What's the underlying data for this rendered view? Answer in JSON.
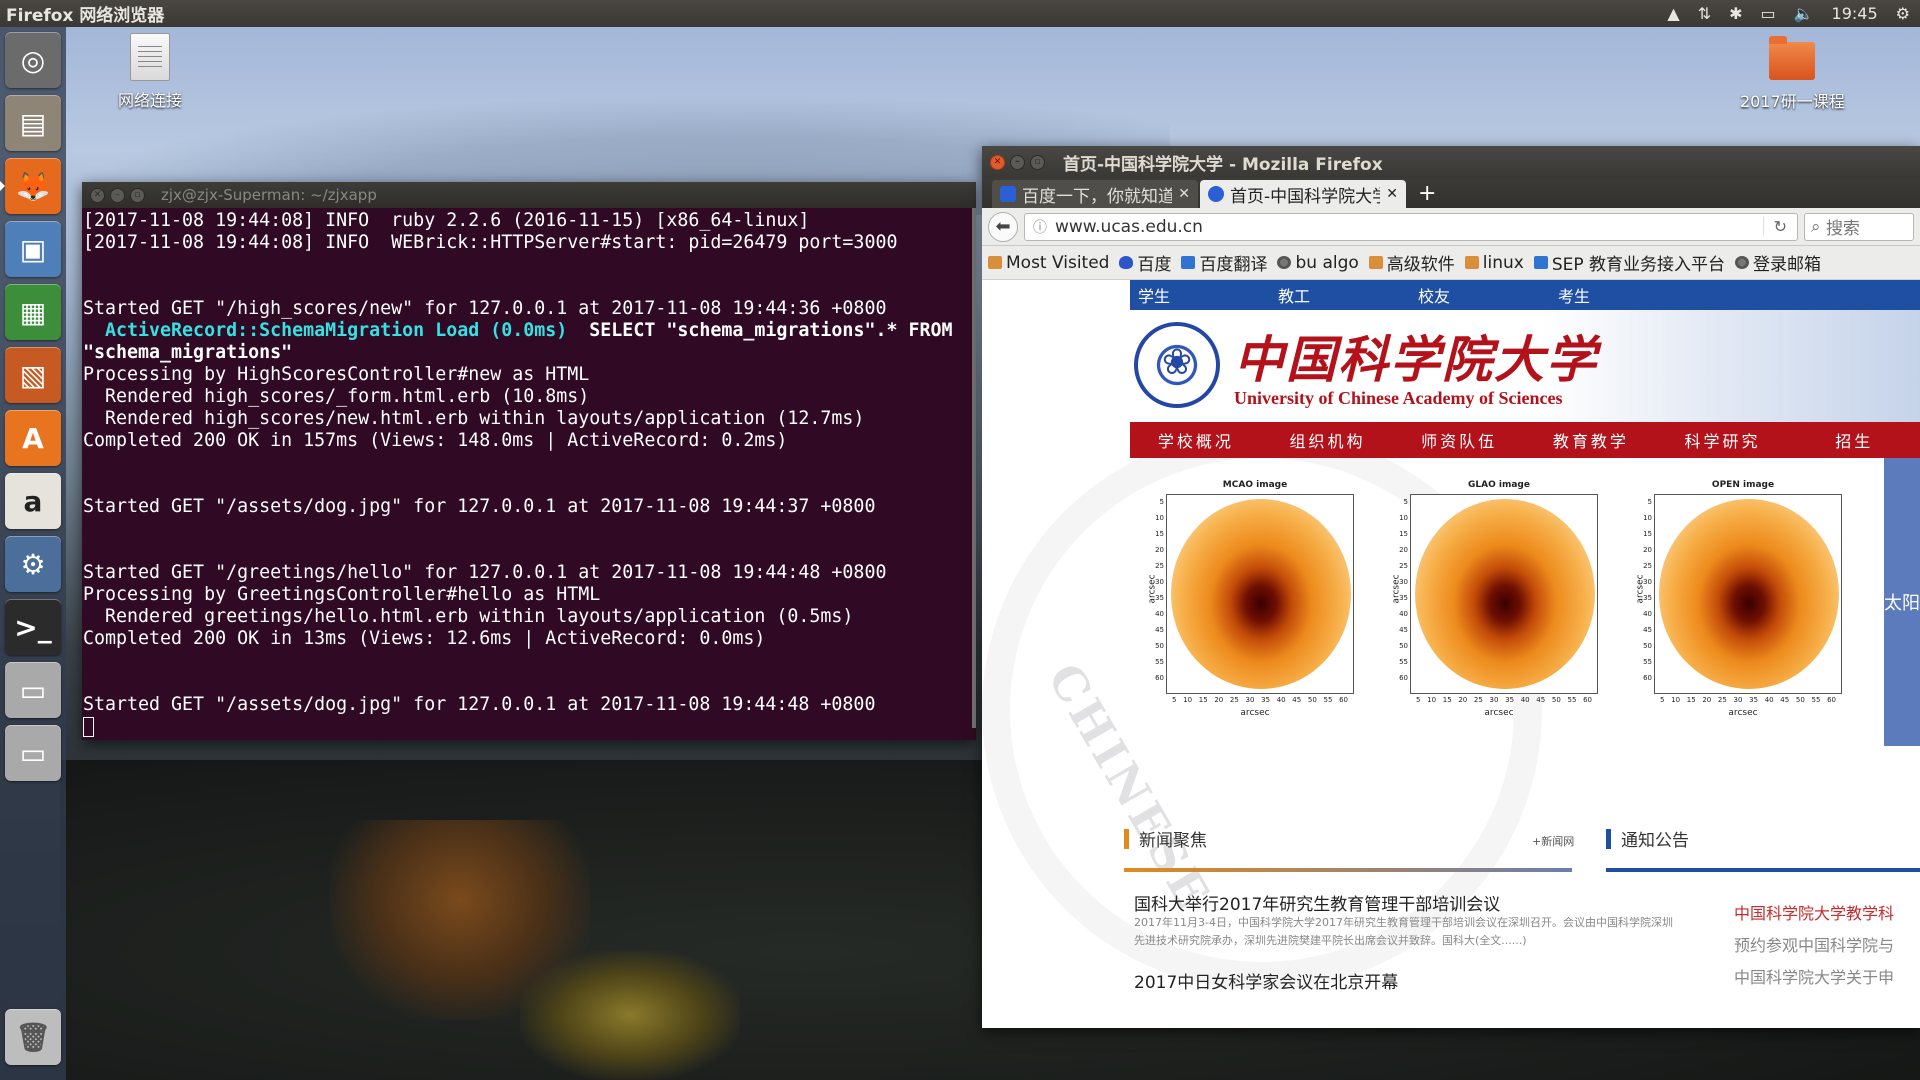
{
  "top_panel": {
    "app_title": "Firefox 网络浏览器",
    "clock": "19:45"
  },
  "launcher": {
    "items": [
      {
        "name": "ubuntu-dash",
        "glyph": "◎",
        "color": "#6b6b6b"
      },
      {
        "name": "files",
        "glyph": "▤",
        "color": "#8e8576"
      },
      {
        "name": "firefox",
        "glyph": "🦊",
        "color": "#e66a1d"
      },
      {
        "name": "image-viewer",
        "glyph": "▣",
        "color": "#4e7fb8"
      },
      {
        "name": "libreoffice-calc",
        "glyph": "▦",
        "color": "#3d8e3b"
      },
      {
        "name": "libreoffice-impress",
        "glyph": "▧",
        "color": "#c75a22"
      },
      {
        "name": "ubuntu-software",
        "glyph": "A",
        "color": "#e8741f"
      },
      {
        "name": "amazon",
        "glyph": "a",
        "color": "#e6e3dc"
      },
      {
        "name": "system-settings",
        "glyph": "⚙",
        "color": "#4b6e9a"
      },
      {
        "name": "terminal",
        "glyph": ">_",
        "color": "#2b2b2b"
      },
      {
        "name": "disk-drive-1",
        "glyph": "▭",
        "color": "#a9a9a9"
      },
      {
        "name": "disk-drive-2",
        "glyph": "▭",
        "color": "#a9a9a9"
      }
    ],
    "trash_glyph": "🗑"
  },
  "desktop": {
    "icon_network": "网络连接",
    "icon_folder": "2017研一课程"
  },
  "terminal": {
    "title": "zjx@zjx-Superman: ~/zjxapp",
    "lines": {
      "l1": "[2017-11-08 19:44:08] INFO  ruby 2.2.6 (2016-11-15) [x86_64-linux]",
      "l2": "[2017-11-08 19:44:08] INFO  WEBrick::HTTPServer#start: pid=26479 port=3000",
      "l3": "Started GET \"/high_scores/new\" for 127.0.0.1 at 2017-11-08 19:44:36 +0800",
      "l4_cyan": "  ActiveRecord::SchemaMigration Load (0.0ms)",
      "l4_rest": "  SELECT \"schema_migrations\".* FROM",
      "l5": "\"schema_migrations\"",
      "l6": "Processing by HighScoresController#new as HTML",
      "l7": "  Rendered high_scores/_form.html.erb (10.8ms)",
      "l8": "  Rendered high_scores/new.html.erb within layouts/application (12.7ms)",
      "l9": "Completed 200 OK in 157ms (Views: 148.0ms | ActiveRecord: 0.2ms)",
      "l10": "Started GET \"/assets/dog.jpg\" for 127.0.0.1 at 2017-11-08 19:44:37 +0800",
      "l11": "Started GET \"/greetings/hello\" for 127.0.0.1 at 2017-11-08 19:44:48 +0800",
      "l12": "Processing by GreetingsController#hello as HTML",
      "l13": "  Rendered greetings/hello.html.erb within layouts/application (0.5ms)",
      "l14": "Completed 200 OK in 13ms (Views: 12.6ms | ActiveRecord: 0.0ms)",
      "l15": "Started GET \"/assets/dog.jpg\" for 127.0.0.1 at 2017-11-08 19:44:48 +0800"
    }
  },
  "firefox": {
    "window_title": "首页-中国科学院大学 - Mozilla Firefox",
    "tabs": [
      {
        "label": "百度一下，你就知道"
      },
      {
        "label": "首页-中国科学院大学"
      }
    ],
    "url": "www.ucas.edu.cn",
    "search_placeholder": "搜索",
    "bookmarks": [
      {
        "label": "Most Visited",
        "icon": "folder"
      },
      {
        "label": "百度",
        "icon": "paw"
      },
      {
        "label": "百度翻译",
        "icon": "blue"
      },
      {
        "label": "bu algo",
        "icon": "globe"
      },
      {
        "label": "高级软件",
        "icon": "folder"
      },
      {
        "label": "linux",
        "icon": "folder"
      },
      {
        "label": "SEP 教育业务接入平台",
        "icon": "blue"
      },
      {
        "label": "登录邮箱",
        "icon": "globe"
      }
    ]
  },
  "page": {
    "top_links": [
      "学生",
      "教工",
      "校友",
      "考生"
    ],
    "logo_cn": "中国科学院大学",
    "logo_en": "University of  Chinese Academy of Sciences",
    "watermark": "CHINESE",
    "main_nav": [
      "学校概况",
      "组织机构",
      "师资队伍",
      "教育教学",
      "科学研究",
      "招生"
    ],
    "slide_side_text": "太阳",
    "panels": [
      {
        "title": "MCAO image"
      },
      {
        "title": "GLAO image"
      },
      {
        "title": "OPEN image"
      }
    ],
    "axis": {
      "xlabel": "arcsec",
      "ylabel": "arcsec",
      "yticks": [
        "5",
        "10",
        "15",
        "20",
        "25",
        "30",
        "35",
        "40",
        "45",
        "50",
        "55",
        "60"
      ],
      "xticks": [
        "5",
        "10",
        "15",
        "20",
        "25",
        "30",
        "35",
        "40",
        "45",
        "50",
        "55",
        "60"
      ]
    },
    "news_heading": "新闻聚焦",
    "news_more": "+新闻网",
    "notice_heading": "通知公告",
    "news": [
      {
        "title": "国科大举行2017年研究生教育管理干部培训会议",
        "desc": "2017年11月3-4日，中国科学院大学2017年研究生教育管理干部培训会议在深圳召开。会议由中国科学院深圳先进技术研究院承办，深圳先进院樊建平院长出席会议并致辞。国科大(全文......)"
      },
      {
        "title": "2017中日女科学家会议在北京开幕",
        "desc": ""
      }
    ],
    "notices": [
      "中国科学院大学教学科",
      "预约参观中国科学院与",
      "中国科学院大学关于申"
    ],
    "colors": {
      "brand_red": "#b3121b",
      "brand_blue": "#1f4fa2"
    }
  }
}
